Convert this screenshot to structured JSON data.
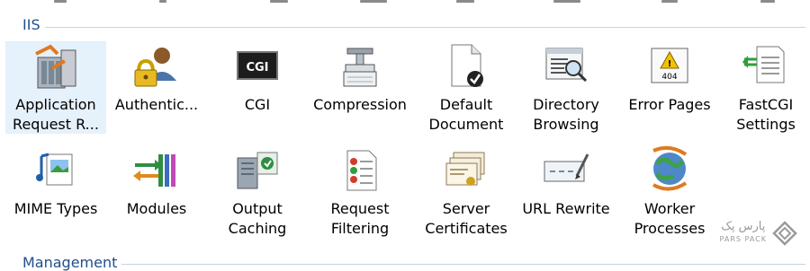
{
  "sections": {
    "iis": "IIS",
    "management": "Management"
  },
  "features_row1": [
    {
      "label": "Application\nRequest R...",
      "icon": "application-request-routing-icon"
    },
    {
      "label": "Authentic...",
      "icon": "authentication-icon"
    },
    {
      "label": "CGI",
      "icon": "cgi-icon"
    },
    {
      "label": "Compression",
      "icon": "compression-icon"
    },
    {
      "label": "Default\nDocument",
      "icon": "default-document-icon"
    },
    {
      "label": "Directory\nBrowsing",
      "icon": "directory-browsing-icon"
    },
    {
      "label": "Error Pages",
      "icon": "error-pages-icon"
    },
    {
      "label": "FastCGI\nSettings",
      "icon": "fastcgi-settings-icon"
    }
  ],
  "features_row2": [
    {
      "label": "MIME Types",
      "icon": "mime-types-icon"
    },
    {
      "label": "Modules",
      "icon": "modules-icon"
    },
    {
      "label": "Output\nCaching",
      "icon": "output-caching-icon"
    },
    {
      "label": "Request\nFiltering",
      "icon": "request-filtering-icon"
    },
    {
      "label": "Server\nCertificates",
      "icon": "server-certificates-icon"
    },
    {
      "label": "URL Rewrite",
      "icon": "url-rewrite-icon"
    },
    {
      "label": "Worker\nProcesses",
      "icon": "worker-processes-icon"
    }
  ],
  "icon_text": {
    "cgi": "CGI",
    "error_code": "404"
  },
  "watermark": {
    "brand": "پارس پک",
    "sub": "PARS PACK"
  },
  "colors": {
    "section_label": "#1f4e8c",
    "selection": "#e5f1fb",
    "divider": "#c8d3e0"
  }
}
